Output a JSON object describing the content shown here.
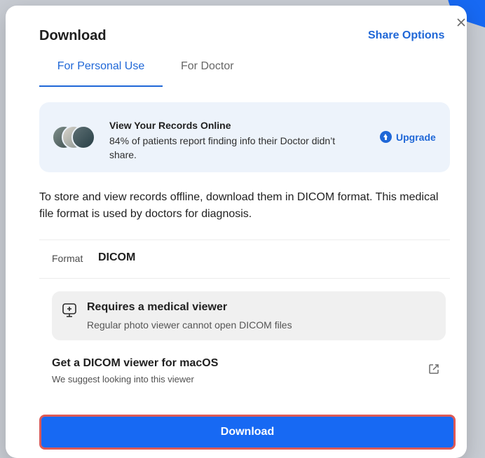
{
  "modal": {
    "title": "Download",
    "share_options": "Share Options"
  },
  "tabs": [
    {
      "label": "For Personal Use",
      "active": true
    },
    {
      "label": "For Doctor",
      "active": false
    }
  ],
  "promo": {
    "title": "View Your Records Online",
    "text": "84% of patients report finding info their Doctor didn’t share.",
    "upgrade_label": "Upgrade"
  },
  "description": "To store and view records offline, download them in DICOM format. This medical file format is used by doctors for diagnosis.",
  "format": {
    "label": "Format",
    "value": "DICOM"
  },
  "viewer_note": {
    "title": "Requires a medical viewer",
    "subtitle": "Regular photo viewer cannot open DICOM files"
  },
  "dicom_viewer": {
    "title": "Get a DICOM viewer for macOS",
    "subtitle": "We suggest looking into this viewer"
  },
  "download_button": "Download",
  "icons": {
    "close": "close-icon",
    "upgrade": "upgrade-icon",
    "viewer": "medical-viewer-icon",
    "external_link": "external-link-icon"
  },
  "colors": {
    "primary": "#1769f3",
    "link": "#1f67d7",
    "promo_bg": "#edf3fb",
    "note_bg": "#f0f0f0",
    "focus_outline": "#dd5a56"
  }
}
